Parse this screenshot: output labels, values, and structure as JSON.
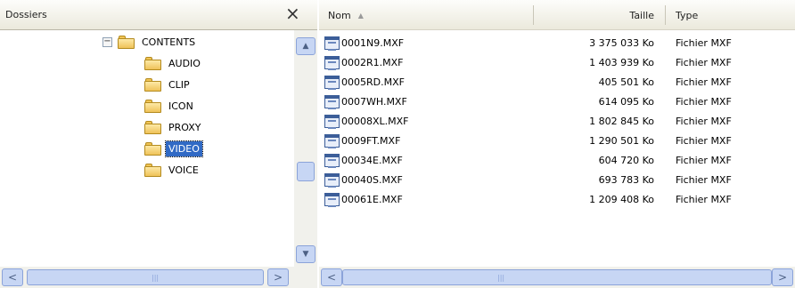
{
  "folders_pane": {
    "title": "Dossiers",
    "close_glyph": "×",
    "tree": [
      {
        "label": "CONTENTS",
        "expanded": true,
        "selected": false
      },
      {
        "label": "AUDIO",
        "selected": false
      },
      {
        "label": "CLIP",
        "selected": false
      },
      {
        "label": "ICON",
        "selected": false
      },
      {
        "label": "PROXY",
        "selected": false
      },
      {
        "label": "VIDEO",
        "selected": true
      },
      {
        "label": "VOICE",
        "selected": false
      }
    ]
  },
  "file_list": {
    "columns": {
      "name": "Nom",
      "size": "Taille",
      "type": "Type"
    },
    "sort_indicator": "▲",
    "files": [
      {
        "name": "0001N9.MXF",
        "size": "3 375 033 Ko",
        "type": "Fichier MXF"
      },
      {
        "name": "0002R1.MXF",
        "size": "1 403 939 Ko",
        "type": "Fichier MXF"
      },
      {
        "name": "0005RD.MXF",
        "size": "405 501 Ko",
        "type": "Fichier MXF"
      },
      {
        "name": "0007WH.MXF",
        "size": "614 095 Ko",
        "type": "Fichier MXF"
      },
      {
        "name": "00008XL.MXF",
        "size": "1 802 845 Ko",
        "type": "Fichier MXF"
      },
      {
        "name": "0009FT.MXF",
        "size": "1 290 501 Ko",
        "type": "Fichier MXF"
      },
      {
        "name": "00034E.MXF",
        "size": "604 720 Ko",
        "type": "Fichier MXF"
      },
      {
        "name": "00040S.MXF",
        "size": "693 783 Ko",
        "type": "Fichier MXF"
      },
      {
        "name": "00061E.MXF",
        "size": "1 209 408 Ko",
        "type": "Fichier MXF"
      }
    ]
  },
  "scroll_glyphs": {
    "up": "▲",
    "down": "▼",
    "left": "<",
    "right": ">",
    "grip": "|||"
  },
  "colors": {
    "selection": "#316ac5",
    "scrollbar": "#c7d6f4"
  }
}
